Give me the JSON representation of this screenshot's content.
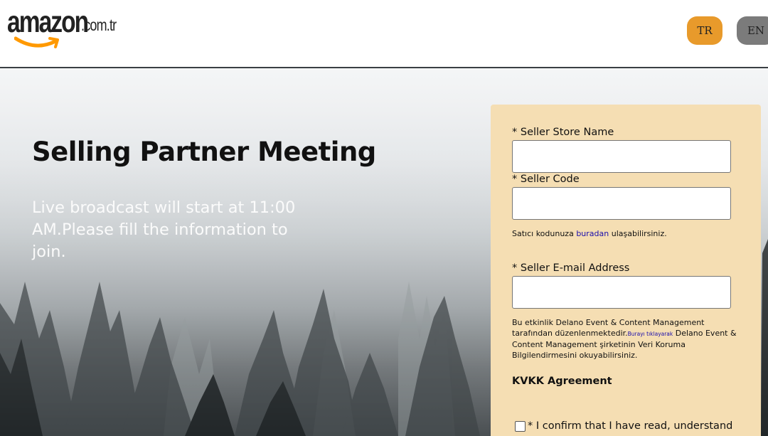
{
  "header": {
    "logo": {
      "main": "amazon",
      "tld": ".com.tr"
    },
    "languages": [
      {
        "code": "TR",
        "color": "#e89a2b"
      },
      {
        "code": "EN",
        "color": "#7b7b7b"
      }
    ]
  },
  "hero": {
    "title": "Selling Partner Meeting",
    "subtitle": "Live broadcast will start at 11:00 AM.Please fill the information to join."
  },
  "form": {
    "background": "#f5deb3",
    "store_name_label": "* Seller Store Name",
    "store_name_value": "",
    "seller_code_label": "* Seller Code",
    "seller_code_value": "",
    "seller_code_note_pre": "Satıcı kodunuza ",
    "seller_code_note_link": "buradan",
    "seller_code_note_post": " ulaşabilirsiniz.",
    "email_label": "* Seller E-mail Address",
    "email_value": "",
    "org_note_pre": "Bu etkinlik Delano Event & Content Management tarafından düzenlenmektedir.",
    "org_note_link": "Burayı tıklayarak",
    "org_note_post": " Delano Event & Content Management şirketinin Veri Koruma Bilgilendirmesini okuyabilirsiniz.",
    "kvkk_title": "KVKK Agreement",
    "confirm_label": "* I confirm that I have read, understand"
  }
}
